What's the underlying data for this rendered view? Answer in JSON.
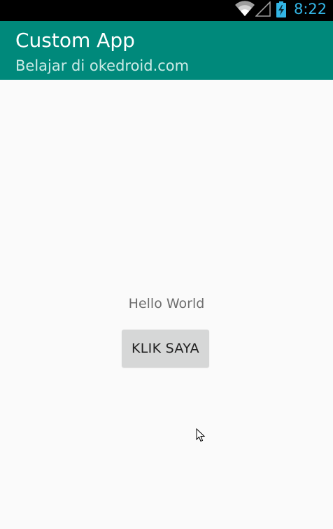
{
  "status_bar": {
    "time": "8:22",
    "icons": [
      "wifi-icon",
      "signal-icon",
      "battery-charging-icon"
    ],
    "clock_color": "#33b5e5"
  },
  "app_bar": {
    "title": "Custom App",
    "subtitle": "Belajar di okedroid.com",
    "color": "#00897b"
  },
  "main": {
    "hello_text": "Hello World",
    "button_label": "KLIK SAYA"
  }
}
